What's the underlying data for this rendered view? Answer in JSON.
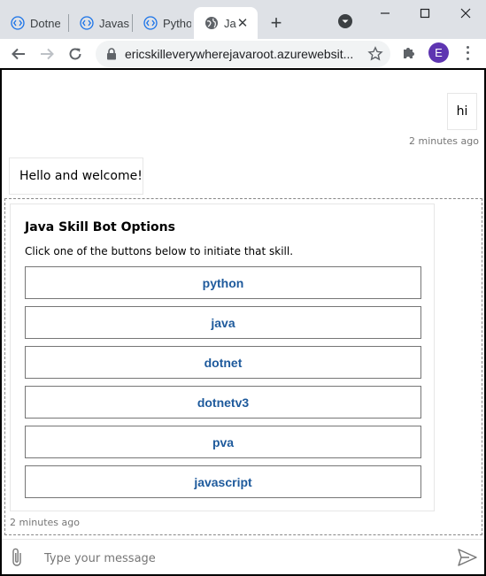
{
  "browser": {
    "tabs": [
      {
        "title": "Dotne",
        "icon": "bot-icon"
      },
      {
        "title": "Javas",
        "icon": "bot-icon"
      },
      {
        "title": "Pytho",
        "icon": "bot-icon"
      },
      {
        "title": "Ja",
        "icon": "globe-icon",
        "active": true
      }
    ],
    "new_tab_label": "+",
    "url": "ericskilleverywherejavaroot.azurewebsit..."
  },
  "profile": {
    "initial": "E",
    "color": "#5e35b1"
  },
  "chat": {
    "user_message": "hi",
    "user_timestamp": "2 minutes ago",
    "bot_message": "Hello and welcome!",
    "card": {
      "title": "Java Skill Bot Options",
      "text": "Click one of the buttons below to initiate that skill.",
      "options": [
        "python",
        "java",
        "dotnet",
        "dotnetv3",
        "pva",
        "javascript"
      ]
    },
    "card_timestamp": "2 minutes ago"
  },
  "compose": {
    "placeholder": "Type your message"
  },
  "colors": {
    "accent": "#1e5a9c",
    "tab_strip": "#dee1e6",
    "omnibox": "#f1f3f4"
  }
}
